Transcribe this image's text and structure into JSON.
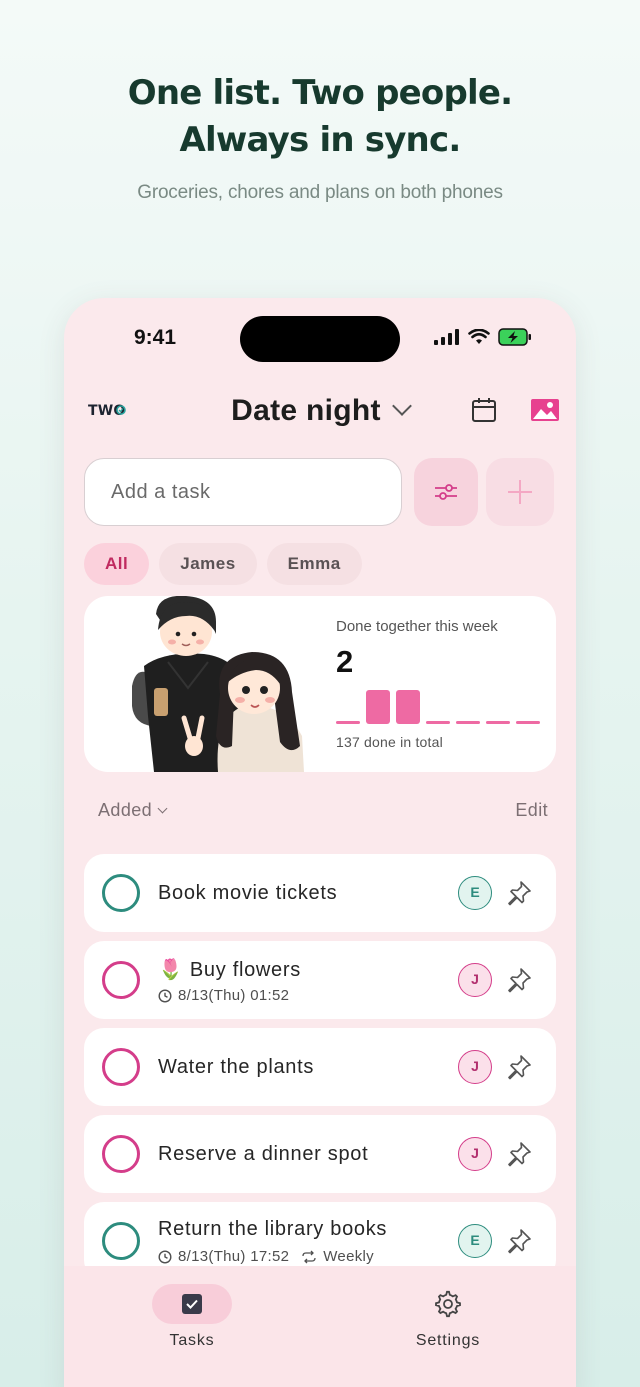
{
  "hero": {
    "title_line1": "One list. Two people.",
    "title_line2": "Always in sync.",
    "subtitle": "Groceries, chores and plans on both phones"
  },
  "status_bar": {
    "time": "9:41"
  },
  "app_bar": {
    "logo_text": "TWO",
    "list_title": "Date night"
  },
  "add_task": {
    "placeholder": "Add a task"
  },
  "filter_chips": [
    {
      "label": "All",
      "active": true
    },
    {
      "label": "James",
      "active": false
    },
    {
      "label": "Emma",
      "active": false
    }
  ],
  "stats_card": {
    "label": "Done together this week",
    "count": "2",
    "week_bars": [
      0,
      1,
      1,
      0,
      0,
      0,
      0
    ],
    "total": "137 done in total"
  },
  "sort": {
    "label": "Added",
    "edit_label": "Edit"
  },
  "tasks": [
    {
      "name": "Book movie tickets",
      "assignee": "E",
      "color": "#2d8c7e"
    },
    {
      "emoji": "🌷",
      "name": "Buy flowers",
      "due": "8/13(Thu) 01:52",
      "assignee": "J",
      "color": "#d43d8a"
    },
    {
      "name": "Water the plants",
      "assignee": "J",
      "color": "#d43d8a"
    },
    {
      "name": "Reserve a dinner spot",
      "assignee": "J",
      "color": "#d43d8a"
    },
    {
      "name": "Return the library books",
      "due": "8/13(Thu) 17:52",
      "repeat": "Weekly",
      "assignee": "E",
      "color": "#2d8c7e"
    }
  ],
  "tab_bar": {
    "tasks_label": "Tasks",
    "settings_label": "Settings"
  },
  "colors": {
    "accent_pink": "#d43d8a",
    "accent_teal": "#2d8c7e",
    "bar_pink": "#ee6aa3",
    "title_green": "#173a2e"
  },
  "icons": [
    "signal-icon",
    "wifi-icon",
    "battery-charging-icon",
    "check-icon",
    "chevron-down-icon",
    "calendar-icon",
    "image-icon",
    "sliders-icon",
    "plus-icon",
    "clock-icon",
    "repeat-icon",
    "pin-icon",
    "gear-icon"
  ]
}
